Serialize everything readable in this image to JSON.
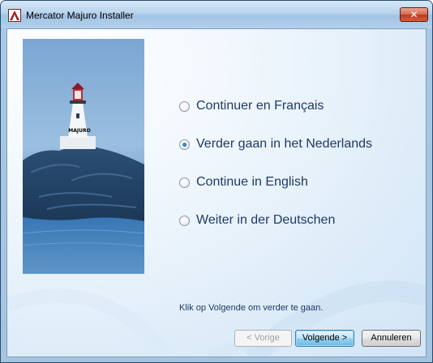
{
  "window": {
    "title": "Mercator Majuro Installer",
    "close_glyph": "✕"
  },
  "banner": {
    "lighthouse_text": "MAJURO"
  },
  "languages": [
    {
      "label": "Continuer en Français",
      "selected": false
    },
    {
      "label": "Verder gaan in het Nederlands",
      "selected": true
    },
    {
      "label": "Continue in English",
      "selected": false
    },
    {
      "label": "Weiter in der Deutschen",
      "selected": false
    }
  ],
  "hint": "Klik op Volgende om verder te gaan.",
  "buttons": {
    "back_label": "< Vorige",
    "next_label": "Volgende >",
    "cancel_label": "Annuleren"
  },
  "icons": {
    "app": "installer-icon",
    "close": "close-icon"
  }
}
